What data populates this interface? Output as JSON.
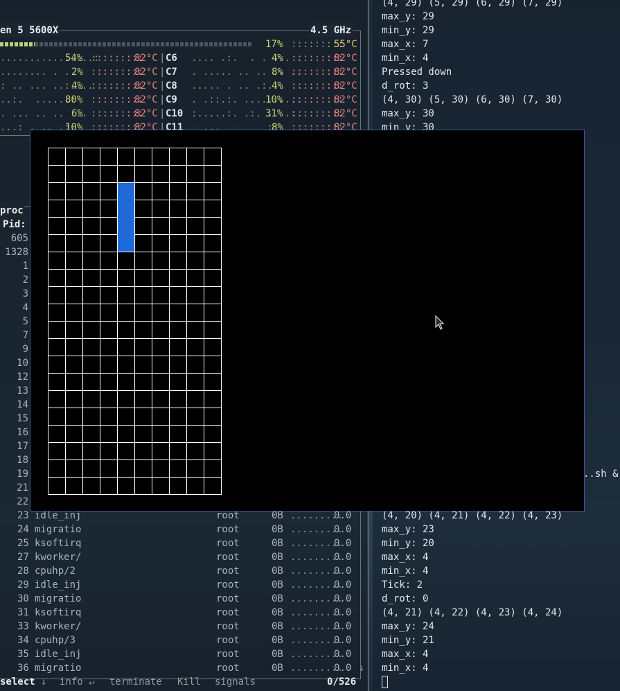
{
  "htop": {
    "cpu_name": "en 5 5600X",
    "freq": "4.5 GHz",
    "total_pct": "17%",
    "total_temp": "55°C",
    "cores_left": [
      {
        "pct": "54%",
        "temp": "82°C"
      },
      {
        "pct": "2%",
        "temp": "82°C"
      },
      {
        "pct": "4%",
        "temp": "82°C"
      },
      {
        "pct": "80%",
        "temp": "82°C"
      },
      {
        "pct": "6%",
        "temp": "82°C"
      },
      {
        "pct": "10%",
        "temp": "82°C"
      }
    ],
    "cores_right": [
      {
        "id": "C6",
        "pct": "4%",
        "temp": "82°C"
      },
      {
        "id": "C7",
        "pct": "8%",
        "temp": "82°C"
      },
      {
        "id": "C8",
        "pct": "4%",
        "temp": "82°C"
      },
      {
        "id": "C9",
        "pct": "10%",
        "temp": "82°C"
      },
      {
        "id": "C10",
        "pct": "31%",
        "temp": "82°C"
      },
      {
        "id": "C11",
        "pct": "8%",
        "temp": "82°C"
      }
    ],
    "proc_label": "proc",
    "pid_label": "Pid:",
    "pids_top": [
      "605",
      "1328",
      "1",
      "2",
      "3",
      "4",
      "5",
      "7",
      "9",
      "10",
      "12",
      "13",
      "14",
      "15",
      "16",
      "17",
      "18",
      "19",
      "21",
      "22"
    ],
    "procs": [
      {
        "pid": "23",
        "name": "idle_inj",
        "user": "root",
        "mem": "0B",
        "cpu": "0.0"
      },
      {
        "pid": "24",
        "name": "migratio",
        "user": "root",
        "mem": "0B",
        "cpu": "0.0"
      },
      {
        "pid": "25",
        "name": "ksoftirq",
        "user": "root",
        "mem": "0B",
        "cpu": "0.0"
      },
      {
        "pid": "27",
        "name": "kworker/",
        "user": "root",
        "mem": "0B",
        "cpu": "0.0"
      },
      {
        "pid": "28",
        "name": "cpuhp/2",
        "user": "root",
        "mem": "0B",
        "cpu": "0.0"
      },
      {
        "pid": "29",
        "name": "idle_inj",
        "user": "root",
        "mem": "0B",
        "cpu": "0.0"
      },
      {
        "pid": "30",
        "name": "migratio",
        "user": "root",
        "mem": "0B",
        "cpu": "0.0"
      },
      {
        "pid": "31",
        "name": "ksoftirq",
        "user": "root",
        "mem": "0B",
        "cpu": "0.0"
      },
      {
        "pid": "33",
        "name": "kworker/",
        "user": "root",
        "mem": "0B",
        "cpu": "0.0"
      },
      {
        "pid": "34",
        "name": "cpuhp/3",
        "user": "root",
        "mem": "0B",
        "cpu": "0.0"
      },
      {
        "pid": "35",
        "name": "idle_inj",
        "user": "root",
        "mem": "0B",
        "cpu": "0.0"
      },
      {
        "pid": "36",
        "name": "migratio",
        "user": "root",
        "mem": "0B",
        "cpu": "0.0"
      }
    ],
    "footer": {
      "select": "select",
      "info": "info",
      "terminate": "terminate",
      "kill": "Kill",
      "signals": "signals",
      "count": "0/526"
    }
  },
  "terminal": {
    "lines_top": [
      "(4, 29) (5, 29) (6, 29) (7, 29)",
      "max_y: 29",
      "min_y: 29",
      "max_x: 7",
      "min_x: 4",
      "Pressed down",
      "d_rot: 3",
      "(4, 30) (5, 30) (6, 30) (7, 30)",
      "max_y: 30",
      "min_y: 30"
    ],
    "partial": "..sh &",
    "lines_bottom": [
      "(4, 20) (4, 21) (4, 22) (4, 23)",
      "max_y: 23",
      "min_y: 20",
      "max_x: 4",
      "min_x: 4",
      "Tick: 2",
      "d_rot: 0",
      "(4, 21) (4, 22) (4, 23) (4, 24)",
      "max_y: 24",
      "min_y: 21",
      "max_x: 4",
      "min_x: 4"
    ]
  },
  "game": {
    "cols": 10,
    "rows": 20,
    "active_piece": {
      "col": 4,
      "row_start": 2,
      "row_end": 5
    },
    "piece_color": "#1f6ad8"
  }
}
